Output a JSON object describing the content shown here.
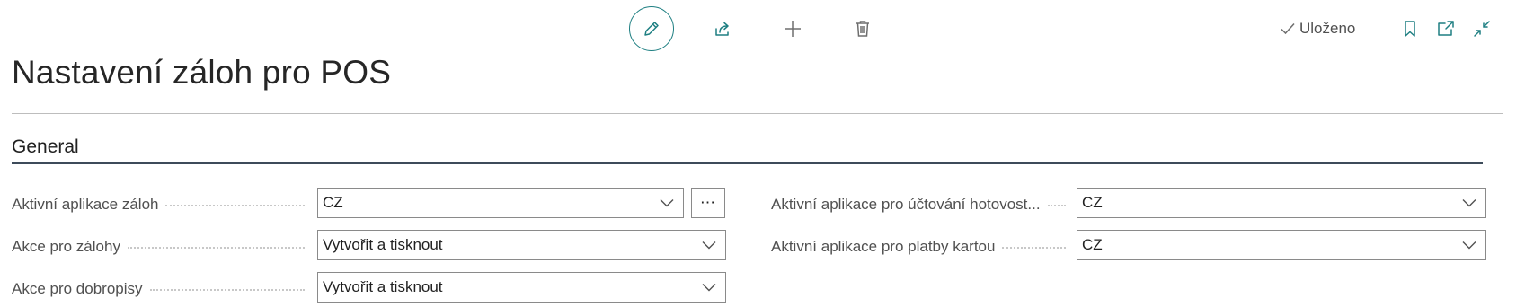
{
  "toolbar": {
    "edit_icon": "pencil-icon",
    "share_icon": "share-icon",
    "new_icon": "plus-icon",
    "delete_icon": "trash-icon",
    "accent": "#1e7f82"
  },
  "status": {
    "icon": "checkmark-icon",
    "text": "Uloženo"
  },
  "actions_right": [
    "bookmark-icon",
    "open-in-new-window-icon",
    "collapse-icon"
  ],
  "page": {
    "title": "Nastavení záloh pro POS"
  },
  "section": {
    "title": "General"
  },
  "fields": {
    "left": [
      {
        "label": "Aktivní aplikace záloh",
        "value": "CZ",
        "has_more": true
      },
      {
        "label": "Akce pro zálohy",
        "value": "Vytvořit a tisknout"
      },
      {
        "label": "Akce pro dobropisy",
        "value": "Vytvořit a tisknout"
      }
    ],
    "right": [
      {
        "label": "Aktivní aplikace pro účtování hotovost...",
        "value": "CZ"
      },
      {
        "label": "Aktivní aplikace pro platby kartou",
        "value": "CZ"
      }
    ],
    "more_label": "⋯"
  }
}
